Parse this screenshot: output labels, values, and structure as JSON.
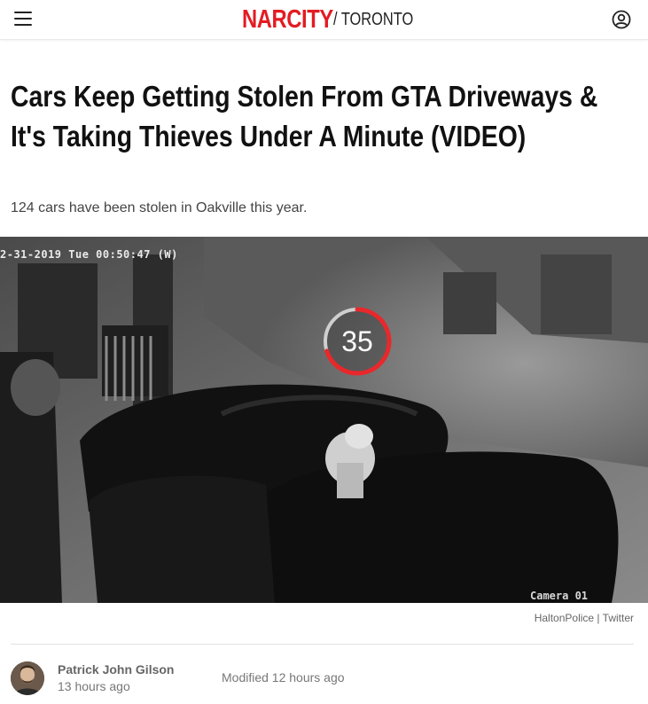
{
  "header": {
    "logo": "NARCITY",
    "region": "/ TORONTO",
    "brand_color": "#e41b23"
  },
  "article": {
    "headline": "Cars Keep Getting Stolen From GTA Driveways & It's Taking Thieves Under A Minute (VIDEO)",
    "subheadline": "124 cars have been stolen in Oakville this year."
  },
  "media": {
    "timestamp": "2-31-2019 Tue 00:50:47 (W)",
    "camera_label": "Camera 01",
    "countdown": "35",
    "countdown_progress": 0.7,
    "credit": "HaltonPolice | Twitter"
  },
  "byline": {
    "author": "Patrick John Gilson",
    "published": "13 hours ago",
    "modified": "Modified 12 hours ago"
  }
}
